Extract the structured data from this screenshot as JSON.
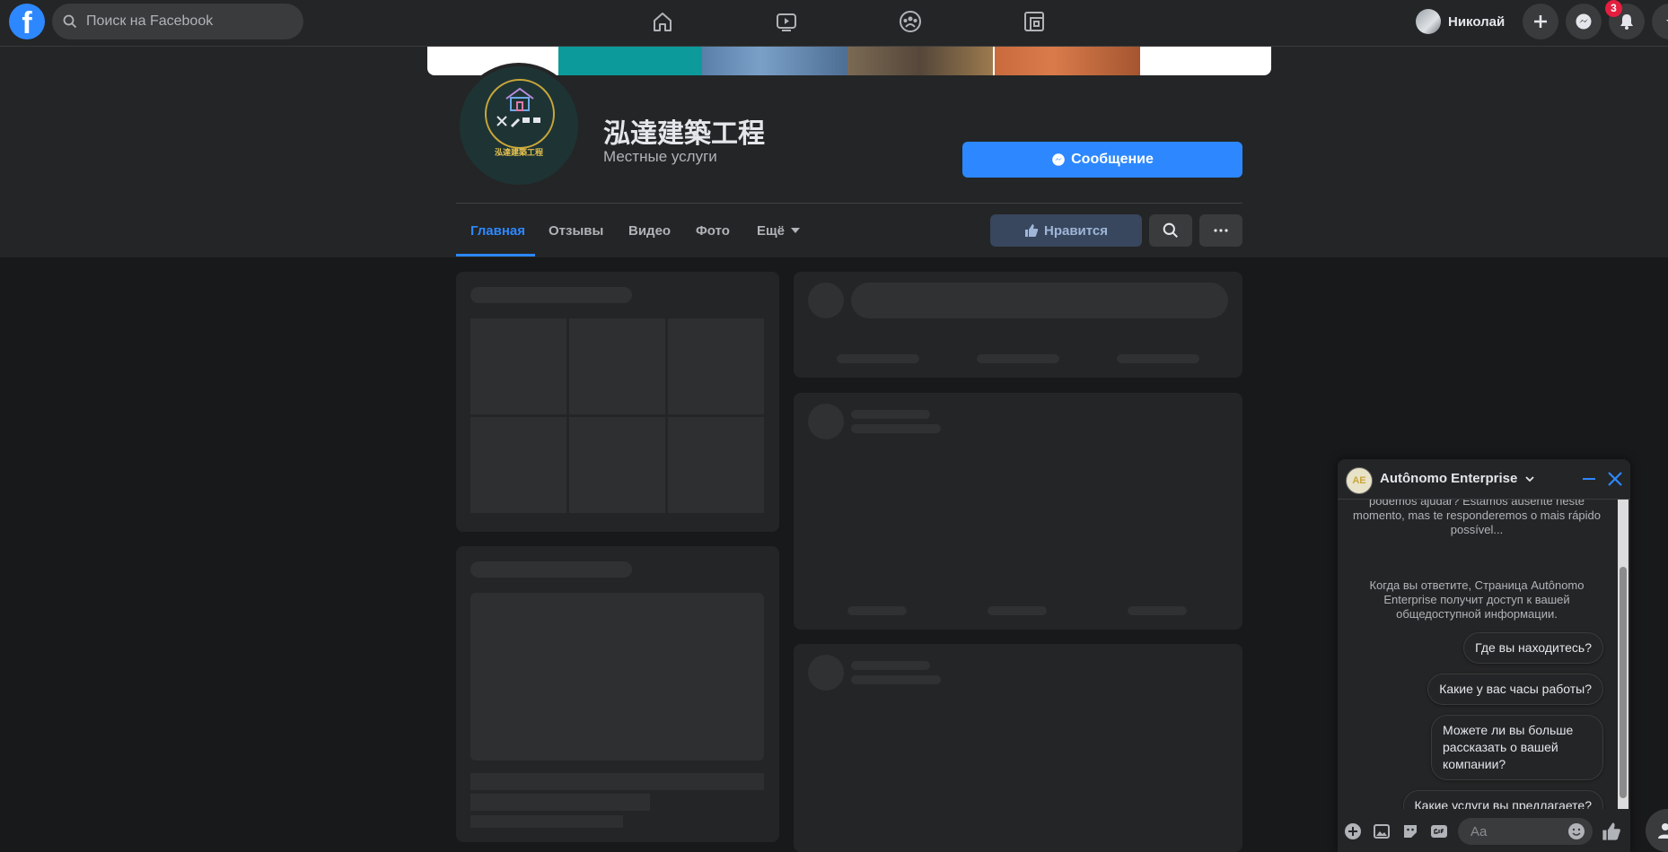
{
  "topbar": {
    "logo": "f",
    "search_placeholder": "Поиск на Facebook",
    "nav_icons": [
      "home-icon",
      "watch-icon",
      "groups-icon",
      "gaming-icon"
    ],
    "user_name": "Николай",
    "notification_count": "3"
  },
  "page": {
    "logo_text": "泓達建築工程",
    "title": "泓達建築工程",
    "category": "Местные услуги",
    "message_button": "Сообщение",
    "tabs": [
      {
        "label": "Главная",
        "active": true
      },
      {
        "label": "Отзывы"
      },
      {
        "label": "Видео"
      },
      {
        "label": "Фото"
      },
      {
        "label": "Ещё"
      }
    ],
    "like_button": "Нравится"
  },
  "chat": {
    "avatar_text": "AE",
    "title": "Autônomo Enterprise",
    "intro_message": "podemos ajudar? Estamos ausente neste momento, mas te responderemos o mais rápido possível...",
    "privacy_note": "Когда вы ответите, Страница Autônomo Enterprise получит доступ к вашей общедоступной информации.",
    "quick_replies": [
      "Где вы находитесь?",
      "Какие у вас часы работы?",
      "Можете ли вы больше рассказать о вашей компании?",
      "Какие услуги вы предлагаете?"
    ],
    "input_placeholder": "Aa"
  },
  "colors": {
    "accent": "#2d88ff",
    "background": "#18191a",
    "surface": "#242526",
    "badge": "#e41e3f",
    "logo_gold": "#c9a63b"
  }
}
